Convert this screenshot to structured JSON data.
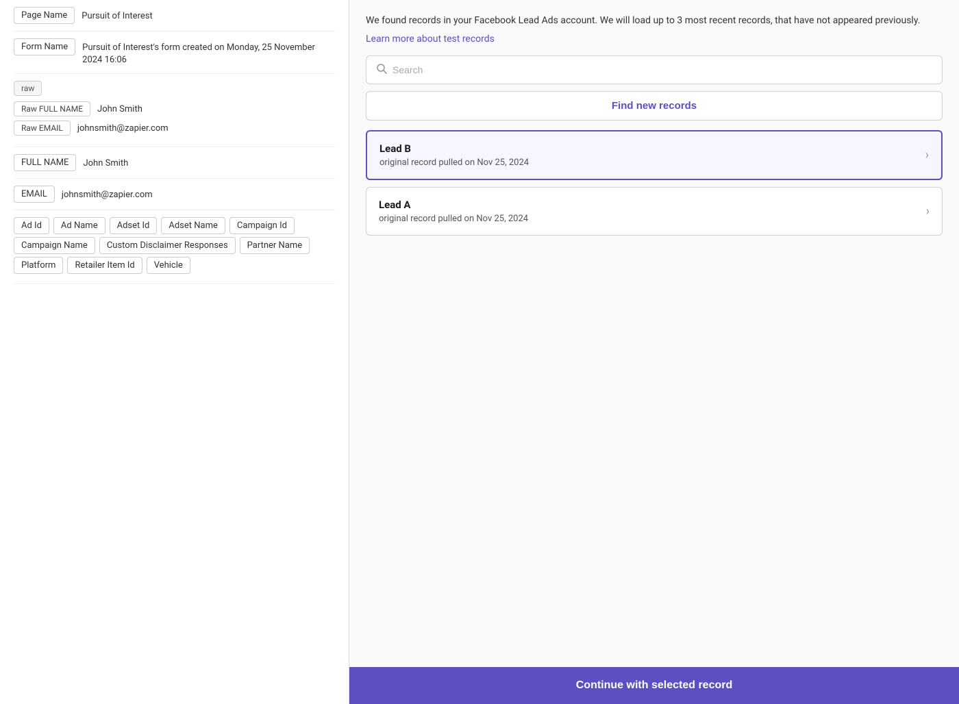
{
  "left": {
    "page_name_label": "Page Name",
    "page_name_value": "Pursuit of Interest",
    "form_name_label": "Form Name",
    "form_name_value": "Pursuit of Interest's form created on Monday, 25 November 2024 16:06",
    "raw_label": "raw",
    "raw_full_name_label": "Raw FULL NAME",
    "raw_full_name_value": "John Smith",
    "raw_email_label": "Raw EMAIL",
    "raw_email_value": "johnsmith@zapier.com",
    "full_name_label": "FULL NAME",
    "full_name_value": "John Smith",
    "email_label": "EMAIL",
    "email_value": "johnsmith@zapier.com",
    "tags": [
      "Ad Id",
      "Ad Name",
      "Adset Id",
      "Adset Name",
      "Campaign Id",
      "Campaign Name",
      "Custom Disclaimer Responses",
      "Partner Name",
      "Platform",
      "Retailer Item Id",
      "Vehicle"
    ]
  },
  "right": {
    "info_text": "We found records in your Facebook Lead Ads account. We will load up to 3 most recent records, that have not appeared previously.",
    "learn_more_text": "Learn more about test records",
    "search_placeholder": "Search",
    "find_records_label": "Find new records",
    "records": [
      {
        "title": "Lead B",
        "subtitle": "original record pulled on Nov 25, 2024",
        "selected": true
      },
      {
        "title": "Lead A",
        "subtitle": "original record pulled on Nov 25, 2024",
        "selected": false
      }
    ],
    "continue_btn_label": "Continue with selected record"
  }
}
